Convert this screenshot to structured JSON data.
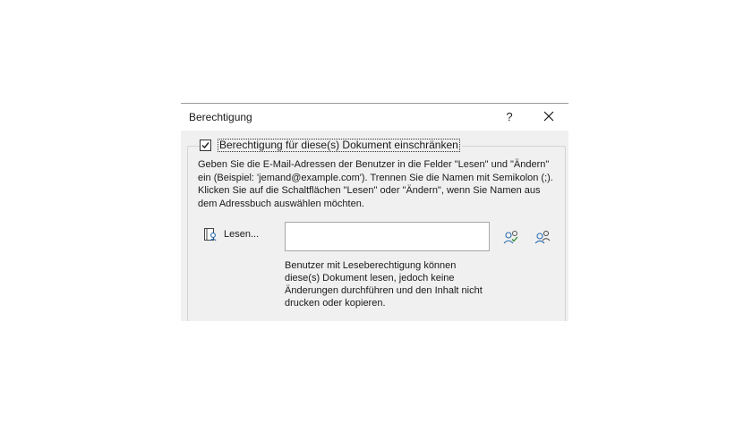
{
  "dialog": {
    "title": "Berechtigung",
    "help_label": "?",
    "close_icon": "close-icon"
  },
  "restrict": {
    "checked": true,
    "label": "Berechtigung für diese(s) Dokument einschränken"
  },
  "instructions": {
    "text": "Geben Sie die E-Mail-Adressen der Benutzer in die Felder \"Lesen\" und \"Ändern\" ein (Beispiel: 'jemand@example.com'). Trennen Sie die Namen mit Semikolon (;). Klicken Sie auf die Schaltflächen \"Lesen\" oder \"Ändern\", wenn Sie Namen aus dem Adressbuch auswählen möchten."
  },
  "read": {
    "button_label": "Lesen...",
    "button_icon": "address-book-icon",
    "input_value": "",
    "input_placeholder": "",
    "contact_icons": [
      "check-names-icon",
      "address-book-people-icon"
    ],
    "hint": "Benutzer mit Leseberechtigung können diese(s) Dokument lesen, jedoch keine Änderungen durchführen und den Inhalt nicht drucken oder kopieren."
  },
  "colors": {
    "accent": "#2b6cb0",
    "dialog_bg": "#f0f0f0",
    "titlebar_bg": "#ffffff"
  }
}
